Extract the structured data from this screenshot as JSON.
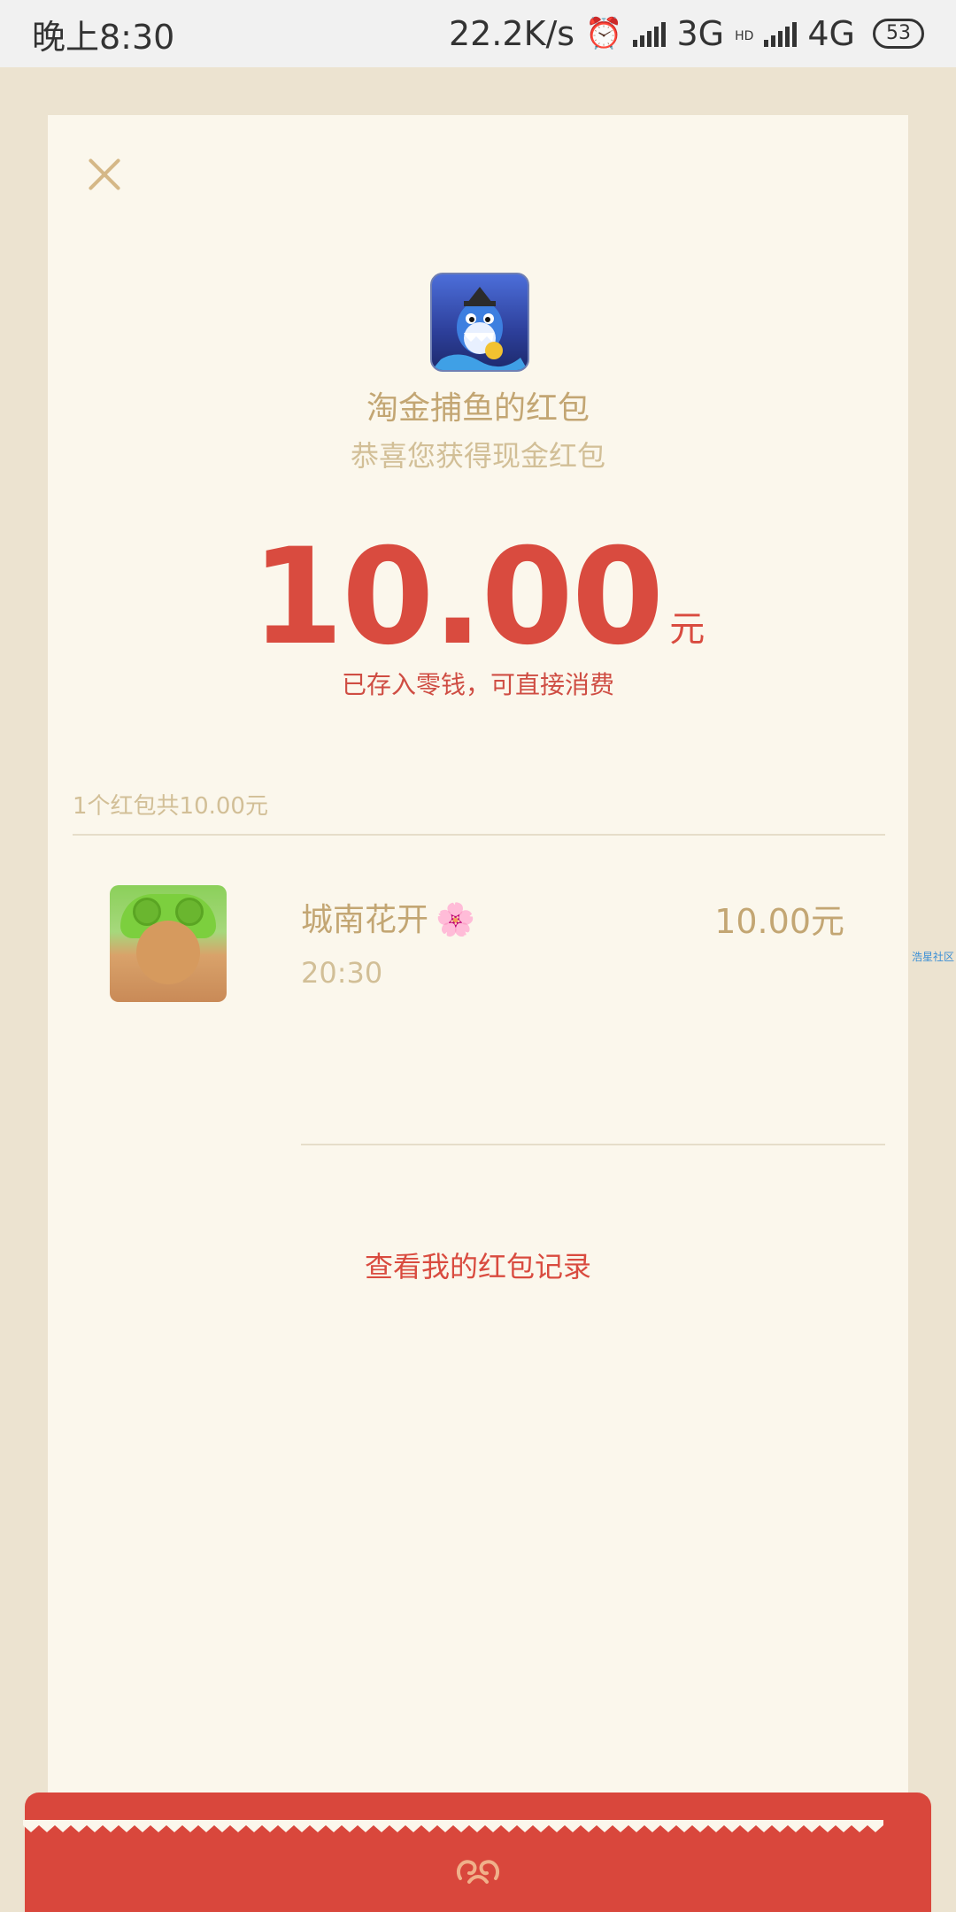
{
  "status_bar": {
    "time": "晚上8:30",
    "net_speed": "22.2K/s",
    "network_3g": "3G",
    "hd_label": "HD",
    "network_4g": "4G",
    "battery": "53"
  },
  "header": {
    "close_icon": "close-icon",
    "app_icon": "shark-game-icon",
    "title": "淘金捕鱼的红包",
    "subtitle": "恭喜您获得现金红包"
  },
  "amount": {
    "value": "10.00",
    "unit": "元",
    "note": "已存入零钱，可直接消费"
  },
  "summary": "1个红包共10.00元",
  "receivers": [
    {
      "name": "城南花开",
      "emoji": "🌸",
      "time": "20:30",
      "amount": "10.00元"
    }
  ],
  "records_link": "查看我的红包记录",
  "watermark": "浩星社区",
  "colors": {
    "accent_red": "#d94b3f",
    "gold": "#c3a673",
    "card_bg": "#fbf7ec",
    "page_bg": "#ece3d0"
  }
}
